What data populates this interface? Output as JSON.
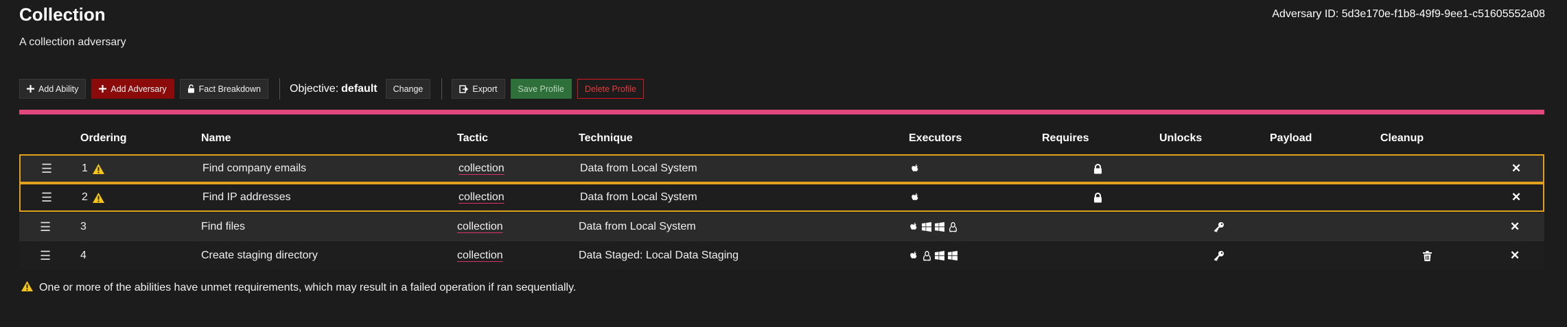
{
  "header": {
    "title": "Collection",
    "description": "A collection adversary",
    "adversary_id": "Adversary ID: 5d3e170e-f1b8-49f9-9ee1-c51605552a08"
  },
  "toolbar": {
    "add_ability": "Add Ability",
    "add_adversary": "Add Adversary",
    "fact_breakdown": "Fact Breakdown",
    "objective_label": "Objective:",
    "objective_value": "default",
    "change": "Change",
    "export": "Export",
    "save_profile": "Save Profile",
    "delete_profile": "Delete Profile"
  },
  "table": {
    "headers": [
      "Ordering",
      "Name",
      "Tactic",
      "Technique",
      "Executors",
      "Requires",
      "Unlocks",
      "Payload",
      "Cleanup"
    ],
    "rows": [
      {
        "order": "1",
        "warn": true,
        "name": "Find company emails",
        "tactic": "collection",
        "technique": "Data from Local System",
        "executors": [
          "apple-icon"
        ],
        "requires": "lock-icon",
        "unlocks": "",
        "cleanup": ""
      },
      {
        "order": "2",
        "warn": true,
        "name": "Find IP addresses",
        "tactic": "collection",
        "technique": "Data from Local System",
        "executors": [
          "apple-icon"
        ],
        "requires": "lock-icon",
        "unlocks": "",
        "cleanup": ""
      },
      {
        "order": "3",
        "warn": false,
        "name": "Find files",
        "tactic": "collection",
        "technique": "Data from Local System",
        "executors": [
          "apple-icon",
          "windows-icon",
          "windows-icon",
          "linux-icon"
        ],
        "requires": "",
        "unlocks": "key-icon",
        "cleanup": ""
      },
      {
        "order": "4",
        "warn": false,
        "name": "Create staging directory",
        "tactic": "collection",
        "technique": "Data Staged: Local Data Staging",
        "executors": [
          "apple-icon",
          "linux-icon",
          "windows-icon",
          "windows-icon"
        ],
        "requires": "",
        "unlocks": "key-icon",
        "cleanup": "trash-icon"
      }
    ]
  },
  "footer_note": "One or more of the abilities have unmet requirements, which may result in a failed operation if ran sequentially.",
  "colors": {
    "background": "#1c1c1d",
    "accent_bar": "#e0487d",
    "warning": "#e1a11d",
    "add_adversary_bg": "#8b0b0b",
    "save_bg": "#2f6f3a",
    "delete_border": "#d9191d"
  }
}
